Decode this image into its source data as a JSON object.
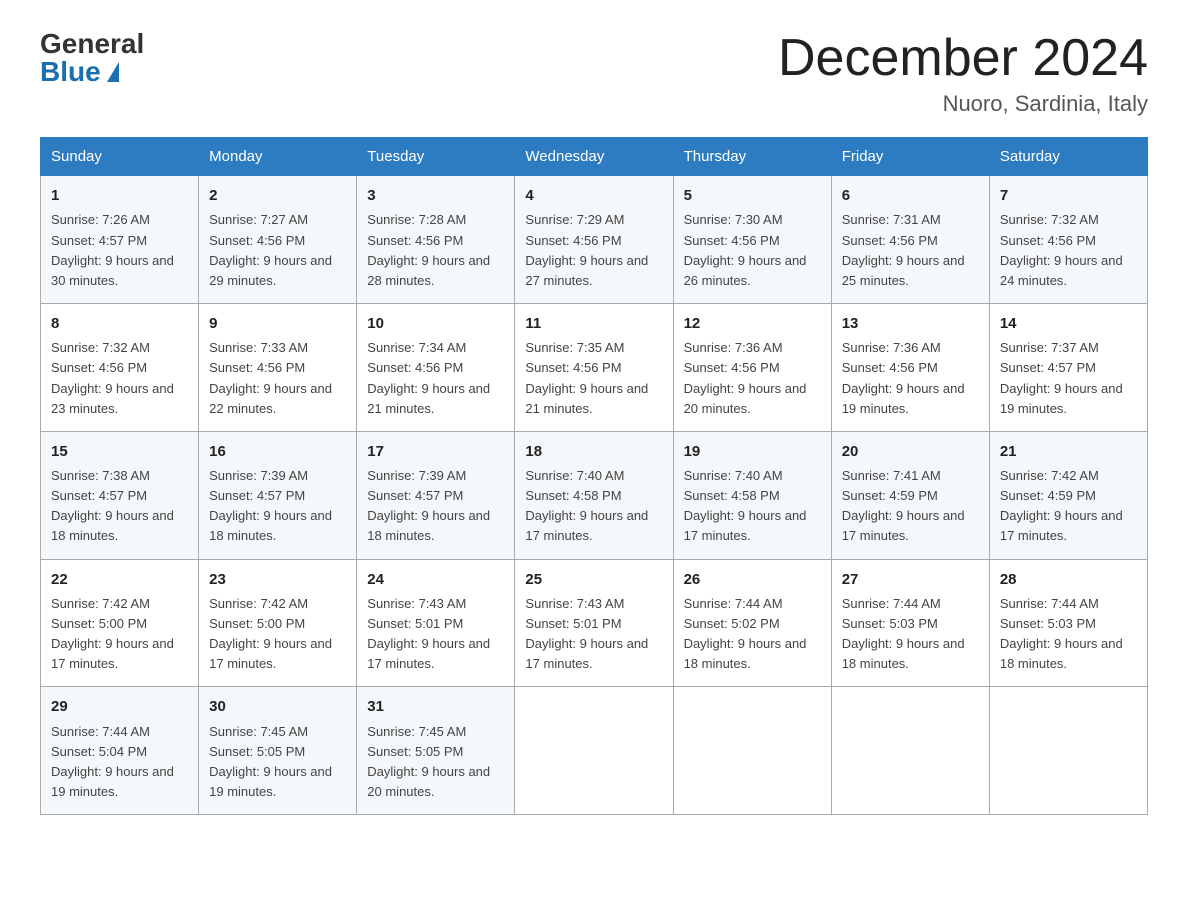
{
  "header": {
    "logo_general": "General",
    "logo_blue": "Blue",
    "month_title": "December 2024",
    "location": "Nuoro, Sardinia, Italy"
  },
  "days_of_week": [
    "Sunday",
    "Monday",
    "Tuesday",
    "Wednesday",
    "Thursday",
    "Friday",
    "Saturday"
  ],
  "weeks": [
    [
      {
        "day": "1",
        "sunrise": "7:26 AM",
        "sunset": "4:57 PM",
        "daylight": "9 hours and 30 minutes."
      },
      {
        "day": "2",
        "sunrise": "7:27 AM",
        "sunset": "4:56 PM",
        "daylight": "9 hours and 29 minutes."
      },
      {
        "day": "3",
        "sunrise": "7:28 AM",
        "sunset": "4:56 PM",
        "daylight": "9 hours and 28 minutes."
      },
      {
        "day": "4",
        "sunrise": "7:29 AM",
        "sunset": "4:56 PM",
        "daylight": "9 hours and 27 minutes."
      },
      {
        "day": "5",
        "sunrise": "7:30 AM",
        "sunset": "4:56 PM",
        "daylight": "9 hours and 26 minutes."
      },
      {
        "day": "6",
        "sunrise": "7:31 AM",
        "sunset": "4:56 PM",
        "daylight": "9 hours and 25 minutes."
      },
      {
        "day": "7",
        "sunrise": "7:32 AM",
        "sunset": "4:56 PM",
        "daylight": "9 hours and 24 minutes."
      }
    ],
    [
      {
        "day": "8",
        "sunrise": "7:32 AM",
        "sunset": "4:56 PM",
        "daylight": "9 hours and 23 minutes."
      },
      {
        "day": "9",
        "sunrise": "7:33 AM",
        "sunset": "4:56 PM",
        "daylight": "9 hours and 22 minutes."
      },
      {
        "day": "10",
        "sunrise": "7:34 AM",
        "sunset": "4:56 PM",
        "daylight": "9 hours and 21 minutes."
      },
      {
        "day": "11",
        "sunrise": "7:35 AM",
        "sunset": "4:56 PM",
        "daylight": "9 hours and 21 minutes."
      },
      {
        "day": "12",
        "sunrise": "7:36 AM",
        "sunset": "4:56 PM",
        "daylight": "9 hours and 20 minutes."
      },
      {
        "day": "13",
        "sunrise": "7:36 AM",
        "sunset": "4:56 PM",
        "daylight": "9 hours and 19 minutes."
      },
      {
        "day": "14",
        "sunrise": "7:37 AM",
        "sunset": "4:57 PM",
        "daylight": "9 hours and 19 minutes."
      }
    ],
    [
      {
        "day": "15",
        "sunrise": "7:38 AM",
        "sunset": "4:57 PM",
        "daylight": "9 hours and 18 minutes."
      },
      {
        "day": "16",
        "sunrise": "7:39 AM",
        "sunset": "4:57 PM",
        "daylight": "9 hours and 18 minutes."
      },
      {
        "day": "17",
        "sunrise": "7:39 AM",
        "sunset": "4:57 PM",
        "daylight": "9 hours and 18 minutes."
      },
      {
        "day": "18",
        "sunrise": "7:40 AM",
        "sunset": "4:58 PM",
        "daylight": "9 hours and 17 minutes."
      },
      {
        "day": "19",
        "sunrise": "7:40 AM",
        "sunset": "4:58 PM",
        "daylight": "9 hours and 17 minutes."
      },
      {
        "day": "20",
        "sunrise": "7:41 AM",
        "sunset": "4:59 PM",
        "daylight": "9 hours and 17 minutes."
      },
      {
        "day": "21",
        "sunrise": "7:42 AM",
        "sunset": "4:59 PM",
        "daylight": "9 hours and 17 minutes."
      }
    ],
    [
      {
        "day": "22",
        "sunrise": "7:42 AM",
        "sunset": "5:00 PM",
        "daylight": "9 hours and 17 minutes."
      },
      {
        "day": "23",
        "sunrise": "7:42 AM",
        "sunset": "5:00 PM",
        "daylight": "9 hours and 17 minutes."
      },
      {
        "day": "24",
        "sunrise": "7:43 AM",
        "sunset": "5:01 PM",
        "daylight": "9 hours and 17 minutes."
      },
      {
        "day": "25",
        "sunrise": "7:43 AM",
        "sunset": "5:01 PM",
        "daylight": "9 hours and 17 minutes."
      },
      {
        "day": "26",
        "sunrise": "7:44 AM",
        "sunset": "5:02 PM",
        "daylight": "9 hours and 18 minutes."
      },
      {
        "day": "27",
        "sunrise": "7:44 AM",
        "sunset": "5:03 PM",
        "daylight": "9 hours and 18 minutes."
      },
      {
        "day": "28",
        "sunrise": "7:44 AM",
        "sunset": "5:03 PM",
        "daylight": "9 hours and 18 minutes."
      }
    ],
    [
      {
        "day": "29",
        "sunrise": "7:44 AM",
        "sunset": "5:04 PM",
        "daylight": "9 hours and 19 minutes."
      },
      {
        "day": "30",
        "sunrise": "7:45 AM",
        "sunset": "5:05 PM",
        "daylight": "9 hours and 19 minutes."
      },
      {
        "day": "31",
        "sunrise": "7:45 AM",
        "sunset": "5:05 PM",
        "daylight": "9 hours and 20 minutes."
      },
      null,
      null,
      null,
      null
    ]
  ],
  "labels": {
    "sunrise": "Sunrise:",
    "sunset": "Sunset:",
    "daylight": "Daylight:"
  },
  "colors": {
    "header_bg": "#2d7cc1",
    "accent": "#1a6faf"
  }
}
